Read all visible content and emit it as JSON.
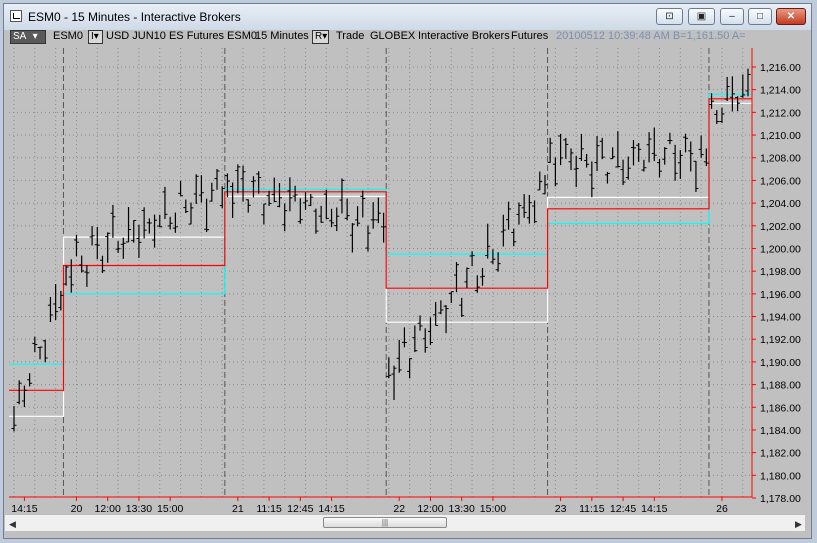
{
  "window": {
    "title": "ESM0 - 15 Minutes - Interactive Brokers"
  },
  "titlebar_buttons": [
    {
      "name": "link-button",
      "glyph": "⊡"
    },
    {
      "name": "snapshot-button",
      "glyph": "▣"
    },
    {
      "name": "minimize-button",
      "glyph": "–"
    },
    {
      "name": "maximize-button",
      "glyph": "□"
    },
    {
      "name": "close-button",
      "glyph": "✕"
    }
  ],
  "infobar": {
    "mode_dropdown": "SA",
    "mode_arrow": "▾",
    "symbol": "ESM0",
    "type_dropdown": "I▾",
    "instrument": "USD JUN10 ES Futures ESM0",
    "interval": "15 Minutes",
    "data_dropdown": "R▾",
    "data_type": "Trade",
    "exchange": "GLOBEX",
    "broker": "Interactive Brokers",
    "category": "Futures",
    "quote": "20100512  10:39:48 AM  B=1,161.50  A="
  },
  "chart_data": {
    "type": "ohlc",
    "y_axis": {
      "min": 1178.0,
      "max": 1216.0,
      "ticks": [
        "1,216.00",
        "1,214.00",
        "1,212.00",
        "1,210.00",
        "1,208.00",
        "1,206.00",
        "1,204.00",
        "1,202.00",
        "1,200.00",
        "1,198.00",
        "1,196.00",
        "1,194.00",
        "1,192.00",
        "1,190.00",
        "1,188.00",
        "1,186.00",
        "1,184.00",
        "1,182.00",
        "1,180.00",
        "1,178.00"
      ]
    },
    "x_axis": {
      "labels": [
        "14:15",
        "20",
        "12:00",
        "13:30",
        "15:00",
        "21",
        "11:15",
        "12:45",
        "14:15",
        "22",
        "12:00",
        "13:30",
        "15:00",
        "23",
        "11:15",
        "12:45",
        "14:15",
        "26"
      ]
    },
    "grid": true,
    "colors": {
      "price": "#000000",
      "red_line": "#ff0000",
      "cyan_line": "#00ffff",
      "white_line": "#ffffff",
      "background": "#c0c0c0",
      "axis": "#ff0000"
    },
    "sessions": [
      {
        "bars": 10,
        "start": 1185.0,
        "end": 1196.5,
        "red": 1187.5,
        "cyan": 1189.8,
        "white": 1185.2
      },
      {
        "bars": 31,
        "start": 1198.5,
        "end": 1205.5,
        "red": 1198.5,
        "cyan": 1196.0,
        "white": 1201.0
      },
      {
        "bars": 31,
        "start": 1205.5,
        "end": 1202.0,
        "red": 1205.0,
        "cyan": 1205.2,
        "white": 1204.6
      },
      {
        "bars": 31,
        "start": 1189.0,
        "end": 1205.5,
        "red": 1196.5,
        "cyan": 1199.5,
        "white": 1193.5
      },
      {
        "bars": 31,
        "start": 1208.0,
        "end": 1208.0,
        "red": 1203.5,
        "cyan": 1202.2,
        "white": 1204.5
      },
      {
        "bars": 8,
        "start": 1212.5,
        "end": 1214.0,
        "red": 1213.2,
        "cyan": 1213.6,
        "white": 1212.8
      }
    ]
  },
  "scrollbar": {
    "left_arrow": "◀",
    "right_arrow": "▶",
    "grip": "|||"
  }
}
